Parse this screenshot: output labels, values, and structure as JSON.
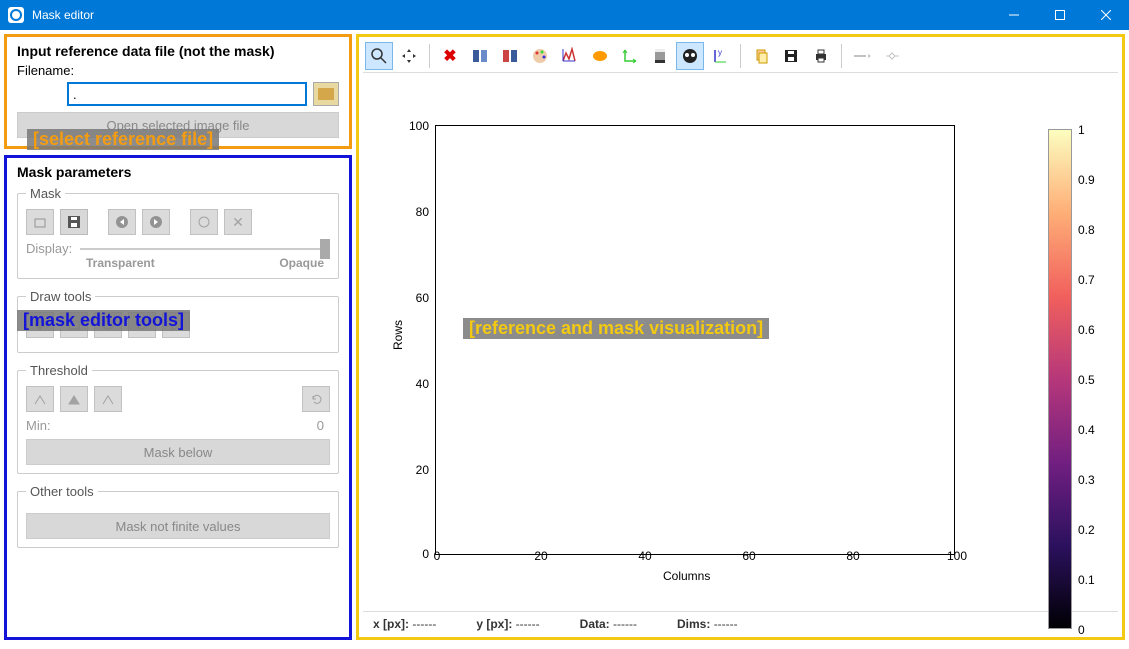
{
  "window": {
    "title": "Mask editor"
  },
  "reference_file": {
    "heading": "Input reference data file (not the mask)",
    "filename_label": "Filename:",
    "filename_value": ".",
    "open_button": "Open selected image file",
    "annotation": "[select reference file]"
  },
  "mask_parameters": {
    "heading": "Mask parameters",
    "annotation": "[mask editor tools]",
    "mask_group": {
      "legend": "Mask",
      "display_label": "Display:",
      "transparent_label": "Transparent",
      "opaque_label": "Opaque"
    },
    "draw_group": {
      "legend": "Draw tools"
    },
    "threshold_group": {
      "legend": "Threshold",
      "min_label": "Min:",
      "min_value": "0",
      "mask_below_button": "Mask below"
    },
    "other_group": {
      "legend": "Other tools",
      "nonfinite_button": "Mask not finite values"
    }
  },
  "chart_data": {
    "type": "empty_plot",
    "title": "",
    "xlabel": "Columns",
    "ylabel": "Rows",
    "x_ticks": [
      0,
      20,
      40,
      60,
      80,
      100
    ],
    "y_ticks": [
      0,
      20,
      40,
      60,
      80,
      100
    ],
    "xlim": [
      0,
      100
    ],
    "ylim": [
      0,
      100
    ],
    "viz_annotation": "[reference and mask visualization]",
    "colorbar_ticks": [
      "1",
      "0.9",
      "0.8",
      "0.7",
      "0.6",
      "0.5",
      "0.4",
      "0.3",
      "0.2",
      "0.1",
      "0"
    ]
  },
  "status": {
    "x_label": "x [px]:",
    "x_value": "------",
    "y_label": "y [px]:",
    "y_value": "------",
    "data_label": "Data:",
    "data_value": "------",
    "dims_label": "Dims:",
    "dims_value": "------"
  }
}
